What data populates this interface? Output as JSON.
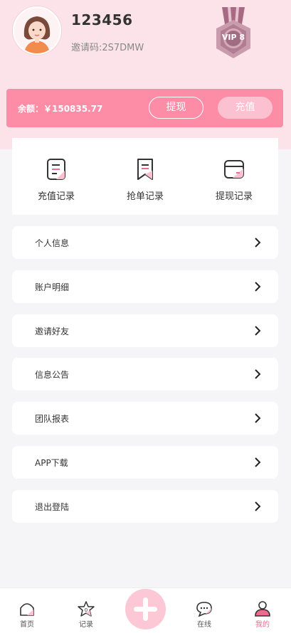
{
  "profile": {
    "username": "123456",
    "invite_code": "邀请码:2S7DMW",
    "vip_label": "VIP 8"
  },
  "balance": {
    "text": "余额：￥150835.77",
    "withdraw_label": "提现",
    "recharge_label": "充值"
  },
  "records": [
    {
      "label": "充值记录",
      "icon": "recharge-record-icon"
    },
    {
      "label": "抢单记录",
      "icon": "grab-order-record-icon"
    },
    {
      "label": "提现记录",
      "icon": "withdraw-record-icon"
    }
  ],
  "menu": [
    {
      "label": "个人信息"
    },
    {
      "label": "账户明细"
    },
    {
      "label": "邀请好友"
    },
    {
      "label": "信息公告"
    },
    {
      "label": "团队报表"
    },
    {
      "label": "APP下载"
    },
    {
      "label": "退出登陆"
    }
  ],
  "tabbar": [
    {
      "label": "首页",
      "icon": "home-icon",
      "active": false
    },
    {
      "label": "记录",
      "icon": "star-record-icon",
      "active": false
    },
    {
      "label": "在线",
      "icon": "chat-bubble-icon",
      "active": false
    },
    {
      "label": "我的",
      "icon": "user-icon",
      "active": true
    }
  ],
  "colors": {
    "accent": "#fd8da6",
    "header_bg": "#fbe3e9",
    "active_tab": "#f06a8d"
  }
}
